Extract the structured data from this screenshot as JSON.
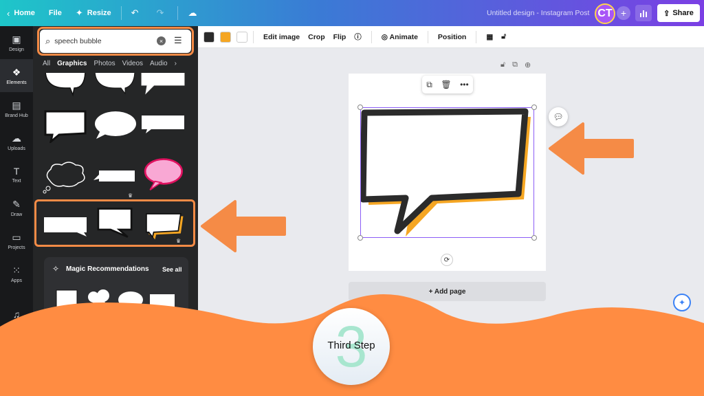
{
  "topbar": {
    "home": "Home",
    "file": "File",
    "resize": "Resize",
    "title": "Untitled design - Instagram Post",
    "avatar_initials": "CT",
    "share": "Share"
  },
  "rail": [
    {
      "label": "Design",
      "icon": "▣"
    },
    {
      "label": "Elements",
      "icon": "❖"
    },
    {
      "label": "Brand Hub",
      "icon": "▤"
    },
    {
      "label": "Uploads",
      "icon": "☁"
    },
    {
      "label": "Text",
      "icon": "T"
    },
    {
      "label": "Draw",
      "icon": "✎"
    },
    {
      "label": "Projects",
      "icon": "▭"
    },
    {
      "label": "Apps",
      "icon": "⁙"
    },
    {
      "label": "Audio",
      "icon": "♫"
    }
  ],
  "search": {
    "value": "speech bubble"
  },
  "tabs": [
    "All",
    "Graphics",
    "Photos",
    "Videos",
    "Audio"
  ],
  "magic": {
    "title": "Magic Recommendations",
    "see_all": "See all"
  },
  "canvas_toolbar": {
    "colors": [
      "#2b2b2b",
      "#f5a623",
      "#ffffff"
    ],
    "edit_image": "Edit image",
    "crop": "Crop",
    "flip": "Flip",
    "animate": "Animate",
    "position": "Position"
  },
  "canvas": {
    "add_page": "+ Add page"
  },
  "step": {
    "number": "3",
    "label": "Third Step"
  },
  "colors": {
    "accent_orange": "#f58b46",
    "panel_bg": "#252627",
    "rail_bg": "#18191b",
    "selection": "#8b5cf6"
  }
}
